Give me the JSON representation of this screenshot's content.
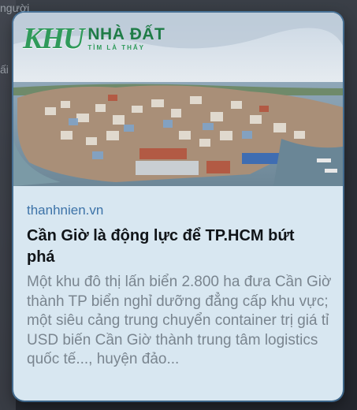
{
  "background": {
    "partial_text_top": "người",
    "partial_text_left": "ấi"
  },
  "card": {
    "logo": {
      "mark": "KHU",
      "name": "NHÀ ĐẤT",
      "tagline": "TÌM LÀ THẤY"
    },
    "source_domain": "thanhnien.vn",
    "title": "Cần Giờ là động lực để TP.HCM bứt phá",
    "description": "Một khu đô thị lấn biển 2.800 ha đưa Cần Giờ thành TP biển nghỉ dưỡng đẳng cấp khu vực; một siêu cảng trung chuyển container trị giá tỉ USD biến Cần Giờ thành trung tâm logistics quốc tế..., huyện đảo...",
    "accent_color": "#3d73a8"
  }
}
